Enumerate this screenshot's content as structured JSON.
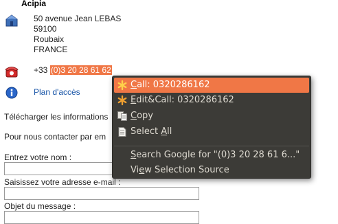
{
  "company": {
    "name": "Acipia"
  },
  "address": {
    "lines": [
      "50 avenue Jean LEBAS",
      "59100",
      "Roubaix",
      "FRANCE"
    ]
  },
  "phone": {
    "prefix": "+33 ",
    "selected": "(0)3 20 28 61 62"
  },
  "links": {
    "map": "Plan d'accès"
  },
  "texts": {
    "download": "Télécharger les informations",
    "contact": "Pour nous contacter par em",
    "name_label": "Entrez votre nom :",
    "email_label": "Saisissez votre adresse e-mail :",
    "subject_label": "Objet du message :"
  },
  "context_menu": {
    "items": [
      {
        "key": "C",
        "rest": "all: 0320286162",
        "icon": "asterisk-icon"
      },
      {
        "key": "E",
        "rest": "dit&Call: 0320286162",
        "icon": "asterisk-icon"
      },
      {
        "key": "C",
        "rest": "opy",
        "icon": "copy-icon"
      },
      {
        "pre": "Select ",
        "key": "A",
        "rest": "ll",
        "icon": "select-all-icon"
      },
      {
        "key": "S",
        "rest": "earch Google for \"(0)3 20 28 61 6...\""
      },
      {
        "pre": "Vi",
        "key": "e",
        "rest": "w Selection Source"
      }
    ]
  },
  "colors": {
    "highlight": "#f07746",
    "menu_bg": "#3c3b37",
    "menu_text": "#dfdbd2",
    "link": "#1a56a8"
  }
}
